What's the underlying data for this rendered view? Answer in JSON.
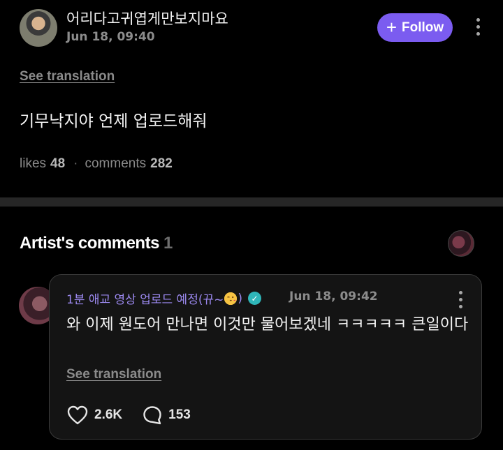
{
  "post": {
    "username": "어리다고귀엽게만보지마요",
    "timestamp": "Jun 18, 09:40",
    "follow_label": "Follow",
    "see_translation": "See translation",
    "content": "기무낙지야 언제 업로드해줘",
    "likes_label": "likes",
    "likes_count": "48",
    "comments_label": "comments",
    "comments_count": "282"
  },
  "artist_comments": {
    "title": "Artist's comments",
    "count": "1",
    "comment": {
      "author": "1분 애교 영상 업로드 예정(뀨~",
      "author_suffix": ")",
      "timestamp": "Jun 18, 09:42",
      "text": "와 이제 원도어 만나면 이것만 물어보겠네 ㅋㅋㅋㅋㅋ 큰일이다",
      "see_translation": "See translation",
      "likes": "2.6K",
      "replies": "153"
    }
  },
  "colors": {
    "accent": "#7b5cf0",
    "artist_name": "#9c89f0",
    "background": "#000000",
    "card": "#141414",
    "verified": "#2fb6b9"
  },
  "icons": [
    "plus-icon",
    "more-vertical-icon",
    "verified-badge-icon",
    "heart-icon",
    "comment-bubble-icon",
    "wink-kiss-emoji"
  ]
}
